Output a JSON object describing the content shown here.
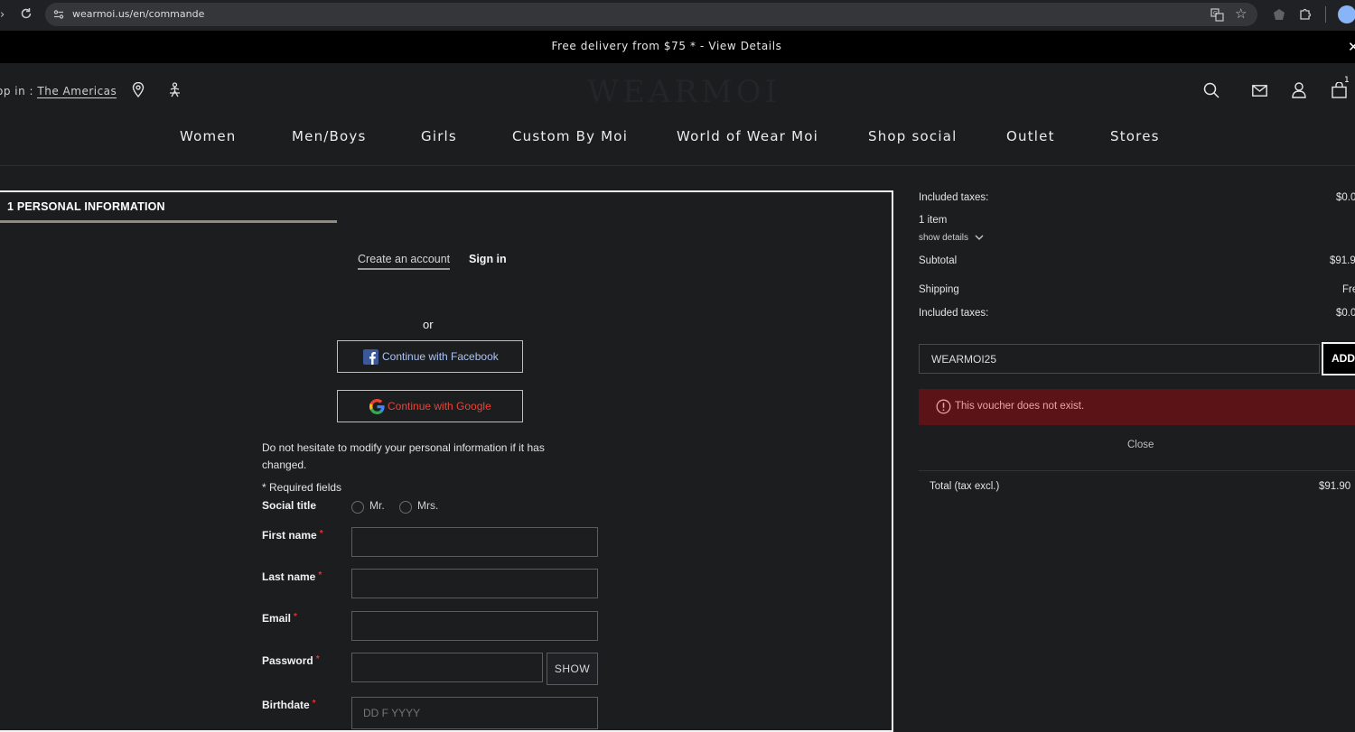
{
  "browser": {
    "url": "wearmoi.us/en/commande"
  },
  "promo": {
    "text": "Free delivery from $75 * - View Details"
  },
  "header": {
    "shop_in_label": "op in :",
    "shop_in_region": "The Americas",
    "logo": "WEARMOI",
    "cart_count": "1"
  },
  "nav": {
    "items": [
      "Women",
      "Men/Boys",
      "Girls",
      "Custom By Moi",
      "World of Wear Moi",
      "Shop social",
      "Outlet",
      "Stores"
    ]
  },
  "checkout": {
    "step_title": "1 PERSONAL INFORMATION",
    "tab_create": "Create an account",
    "tab_signin": "Sign in",
    "or_text": "or",
    "facebook_label": "Continue with Facebook",
    "google_label": "Continue with Google",
    "info_line1": "Do not hesitate to modify your personal information if it has",
    "info_line2": "changed.",
    "required_note": "Required fields",
    "social_title_label": "Social title",
    "mr_label": "Mr.",
    "mrs_label": "Mrs.",
    "first_name_label": "First name",
    "last_name_label": "Last name",
    "email_label": "Email",
    "password_label": "Password",
    "show_label": "SHOW",
    "birthdate_label": "Birthdate",
    "birthdate_placeholder": "DD F YYYY"
  },
  "summary": {
    "included_taxes_label": "Included taxes:",
    "included_taxes_value_top": "$0.0",
    "items_count": "1 item",
    "show_details": "show details",
    "subtotal_label": "Subtotal",
    "subtotal_value": "$91.9",
    "shipping_label": "Shipping",
    "shipping_value": "Fre",
    "included_taxes_value": "$0.0",
    "voucher_code": "WEARMOI25",
    "voucher_add": "ADD",
    "voucher_error": "This voucher does not exist.",
    "close_label": "Close",
    "total_label": "Total (tax excl.)",
    "total_value": "$91.90"
  },
  "colors": {
    "background": "#1c1d1f",
    "error_bg": "#5b1318",
    "facebook_blue": "#3b5998",
    "google_red": "#ea4335"
  }
}
